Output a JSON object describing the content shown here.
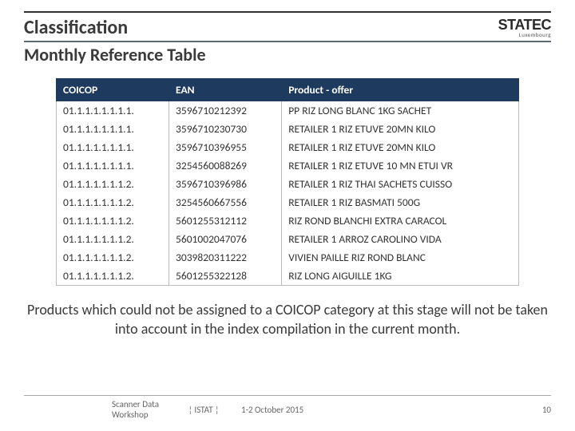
{
  "header": {
    "title": "Classification",
    "logo_main": "STATEC",
    "logo_sub": "Luxembourg"
  },
  "subtitle": "Monthly Reference Table",
  "table": {
    "headers": [
      "COICOP",
      "EAN",
      "Product - offer"
    ],
    "rows": [
      [
        "01.1.1.1.1.1.1.1.",
        "3596710212392",
        "PP RIZ LONG BLANC 1KG SACHET"
      ],
      [
        "01.1.1.1.1.1.1.1.",
        "3596710230730",
        "RETAILER 1 RIZ ETUVE 20MN KILO"
      ],
      [
        "01.1.1.1.1.1.1.1.",
        "3596710396955",
        "RETAILER 1 RIZ ETUVE 20MN KILO"
      ],
      [
        "01.1.1.1.1.1.1.1.",
        "3254560088269",
        "RETAILER 1 RIZ ETUVE 10 MN ETUI VR"
      ],
      [
        "01.1.1.1.1.1.1.2.",
        "3596710396986",
        "RETAILER 1 RIZ THAI SACHETS CUISSO"
      ],
      [
        "01.1.1.1.1.1.1.2.",
        "3254560667556",
        "RETAILER 1 RIZ BASMATI 500G"
      ],
      [
        "01.1.1.1.1.1.1.2.",
        "5601255312112",
        "RIZ ROND BLANCHI EXTRA CARACOL"
      ],
      [
        "01.1.1.1.1.1.1.2.",
        "5601002047076",
        "RETAILER 1 ARROZ CAROLINO VIDA"
      ],
      [
        "01.1.1.1.1.1.1.2.",
        "3039820311222",
        "VIVIEN PAILLE RIZ ROND BLANC"
      ],
      [
        "01.1.1.1.1.1.1.2.",
        "5601255322128",
        "RIZ LONG AIGUILLE 1KG"
      ]
    ]
  },
  "note": "Products which could not be assigned to a COICOP category at this stage will not be taken into account in the index compilation in the current month.",
  "footer": {
    "left": "Scanner Data Workshop",
    "mid": "¦ ISTAT ¦",
    "right": "1-2 October 2015",
    "page": "10"
  }
}
